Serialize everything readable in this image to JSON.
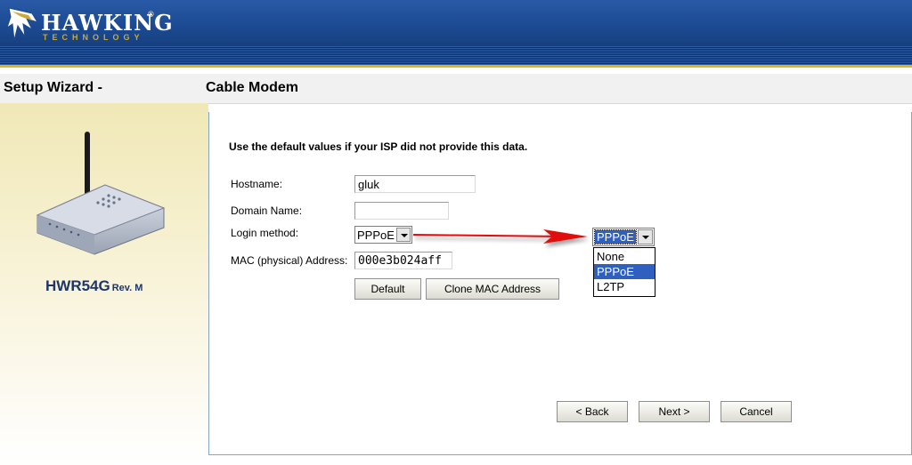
{
  "brand": {
    "name": "HAWKING",
    "tagline": "TECHNOLOGY",
    "registered": "®"
  },
  "page": {
    "wizard_title": "Setup Wizard -",
    "section_title": "Cable Modem"
  },
  "product": {
    "model": "HWR54G",
    "revision": "Rev. M"
  },
  "form": {
    "intro": "Use the default values if your ISP did not provide this data.",
    "hostname": {
      "label": "Hostname:",
      "value": "gluk"
    },
    "domain_name": {
      "label": "Domain Name:",
      "value": ""
    },
    "login_method": {
      "label": "Login method:",
      "selected": "PPPoE"
    },
    "mac": {
      "label": "MAC (physical) Address:",
      "value": "000e3b024aff"
    },
    "default_button": "Default",
    "clone_mac_button": "Clone MAC Address"
  },
  "dropdown": {
    "selected": "PPPoE",
    "options": [
      "None",
      "PPPoE",
      "L2TP"
    ],
    "highlighted_index": 1
  },
  "nav": {
    "back": "< Back",
    "next": "Next >",
    "cancel": "Cancel"
  },
  "colors": {
    "header_blue": "#1c4a93",
    "accent_gold": "#e2b320",
    "selection_blue": "#2f5fbf",
    "annotation_arrow": "#e01010"
  }
}
